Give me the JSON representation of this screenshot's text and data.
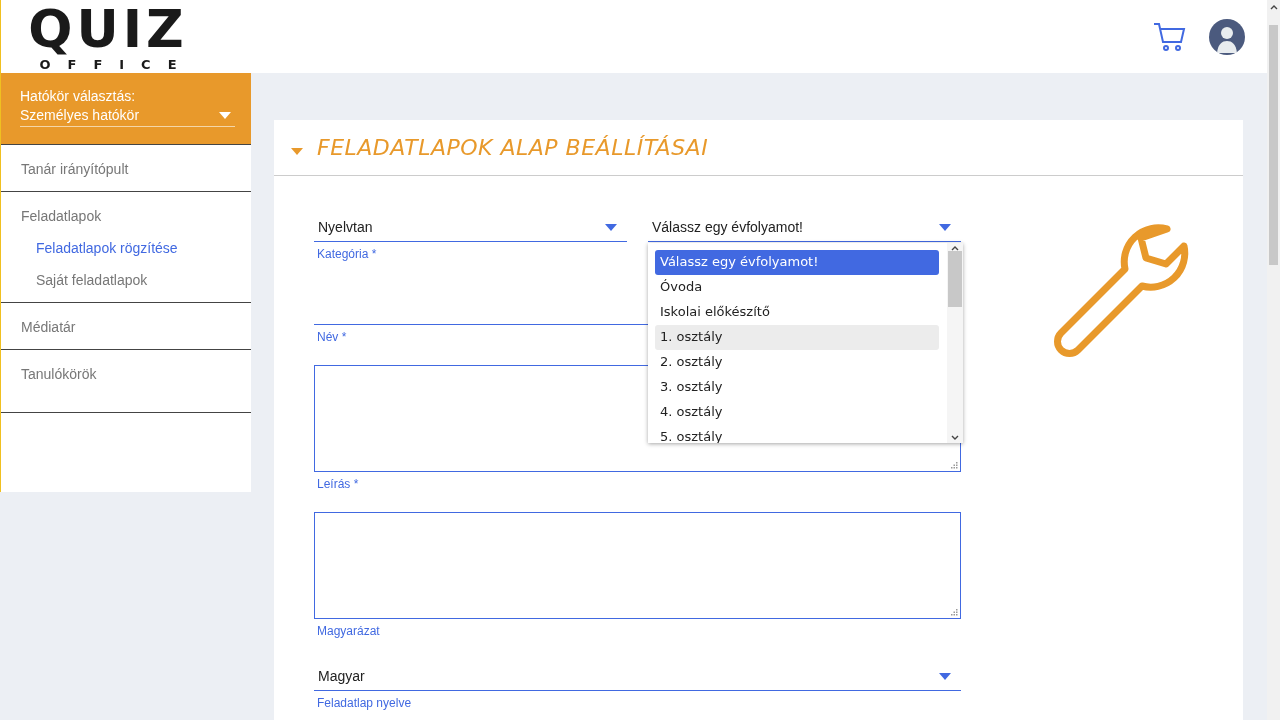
{
  "logo": {
    "word": "QUIZ",
    "subword": "OFFICE"
  },
  "scope": {
    "label": "Hatókör választás:",
    "value": "Személyes hatókör"
  },
  "sidebar": {
    "items": [
      {
        "label": "Tanár irányítópult",
        "selected": false
      },
      {
        "label": "Feladatlapok",
        "selected": false,
        "children": [
          {
            "label": "Feladatlapok rögzítése",
            "selected": true
          },
          {
            "label": "Saját feladatlapok",
            "selected": false
          }
        ]
      },
      {
        "label": "Médiatár",
        "selected": false
      },
      {
        "label": "Tanulókörök",
        "selected": false
      }
    ]
  },
  "card": {
    "title": "FELADATLAPOK ALAP BEÁLLÍTÁSAI",
    "expanded": true
  },
  "form": {
    "category": {
      "value": "Nyelvtan",
      "label": "Kategória *"
    },
    "grade": {
      "value": "Válassz egy évfolyamot!",
      "options": [
        {
          "label": "Válassz egy évfolyamot!",
          "selected": true,
          "hovered": false
        },
        {
          "label": "Óvoda",
          "selected": false,
          "hovered": false
        },
        {
          "label": "Iskolai előkészítő",
          "selected": false,
          "hovered": false
        },
        {
          "label": "1. osztály",
          "selected": false,
          "hovered": true
        },
        {
          "label": "2. osztály",
          "selected": false,
          "hovered": false
        },
        {
          "label": "3. osztály",
          "selected": false,
          "hovered": false
        },
        {
          "label": "4. osztály",
          "selected": false,
          "hovered": false
        },
        {
          "label": "5. osztály",
          "selected": false,
          "hovered": false
        }
      ]
    },
    "name": {
      "label": "Név *"
    },
    "description": {
      "label": "Leírás *"
    },
    "explanation": {
      "label": "Magyarázat"
    },
    "language": {
      "value": "Magyar",
      "label": "Feladatlap nyelve"
    }
  }
}
